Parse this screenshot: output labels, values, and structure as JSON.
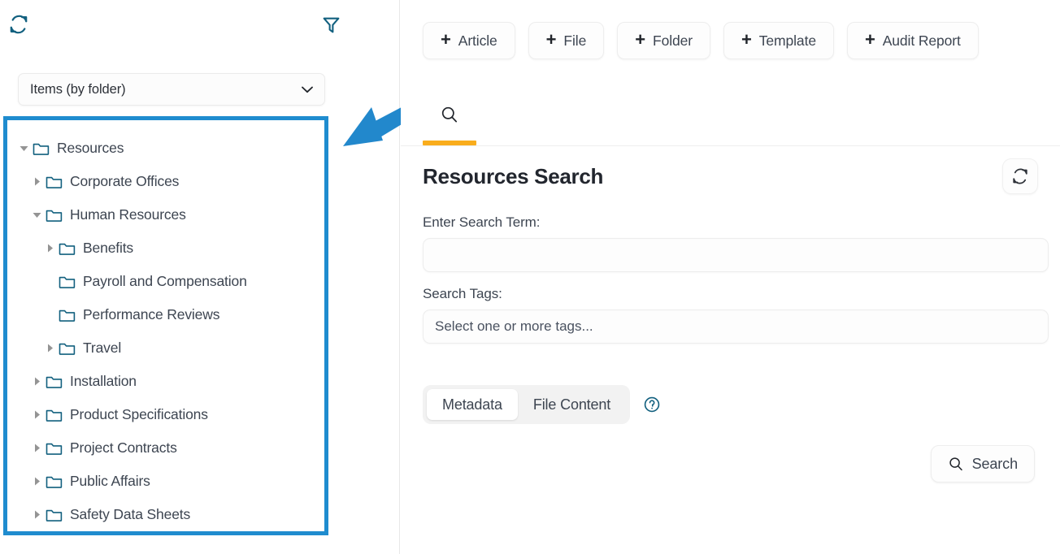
{
  "left_panel": {
    "toolbar": {
      "refresh_icon": "refresh-icon",
      "filter_icon": "filter-icon"
    },
    "folder_select": {
      "value": "Items (by folder)",
      "chevron_icon": "chevron-down-icon"
    },
    "tree": {
      "items": [
        {
          "label": "Resources",
          "depth": 0,
          "caret": "down",
          "icon": "folder-icon"
        },
        {
          "label": "Corporate Offices",
          "depth": 1,
          "caret": "right",
          "icon": "folder-icon"
        },
        {
          "label": "Human Resources",
          "depth": 1,
          "caret": "down",
          "icon": "folder-icon"
        },
        {
          "label": "Benefits",
          "depth": 2,
          "caret": "right",
          "icon": "folder-icon"
        },
        {
          "label": "Payroll and Compensation",
          "depth": 2,
          "caret": "none",
          "icon": "folder-icon"
        },
        {
          "label": "Performance Reviews",
          "depth": 2,
          "caret": "none",
          "icon": "folder-icon"
        },
        {
          "label": "Travel",
          "depth": 2,
          "caret": "right",
          "icon": "folder-icon"
        },
        {
          "label": "Installation",
          "depth": 1,
          "caret": "right",
          "icon": "folder-icon"
        },
        {
          "label": "Product Specifications",
          "depth": 1,
          "caret": "right",
          "icon": "folder-icon"
        },
        {
          "label": "Project Contracts",
          "depth": 1,
          "caret": "right",
          "icon": "folder-icon"
        },
        {
          "label": "Public Affairs",
          "depth": 1,
          "caret": "right",
          "icon": "folder-icon"
        },
        {
          "label": "Safety Data Sheets",
          "depth": 1,
          "caret": "right",
          "icon": "folder-icon"
        }
      ]
    }
  },
  "annotation": {
    "arrow_color": "#2288cc",
    "highlight_color": "#1f8ccf"
  },
  "right_panel": {
    "create_buttons": [
      {
        "label": "Article",
        "plus": "+"
      },
      {
        "label": "File",
        "plus": "+"
      },
      {
        "label": "Folder",
        "plus": "+"
      },
      {
        "label": "Template",
        "plus": "+"
      },
      {
        "label": "Audit Report",
        "plus": "+"
      }
    ],
    "tabs": [
      {
        "name": "search",
        "icon": "search-icon",
        "active": true
      }
    ],
    "tab_indicator_color": "#f9ad1c",
    "panel_title": "Resources Search",
    "refresh_icon": "refresh-icon",
    "search_term": {
      "label": "Enter Search Term:",
      "value": "",
      "placeholder": ""
    },
    "search_tags": {
      "label": "Search Tags:",
      "value": "",
      "placeholder": "Select one or more tags..."
    },
    "mode_toggle": {
      "options": [
        {
          "label": "Metadata",
          "active": true
        },
        {
          "label": "File Content",
          "active": false
        }
      ],
      "help_icon": "help-circle-icon"
    },
    "search_button": {
      "label": "Search",
      "icon": "search-icon"
    }
  }
}
